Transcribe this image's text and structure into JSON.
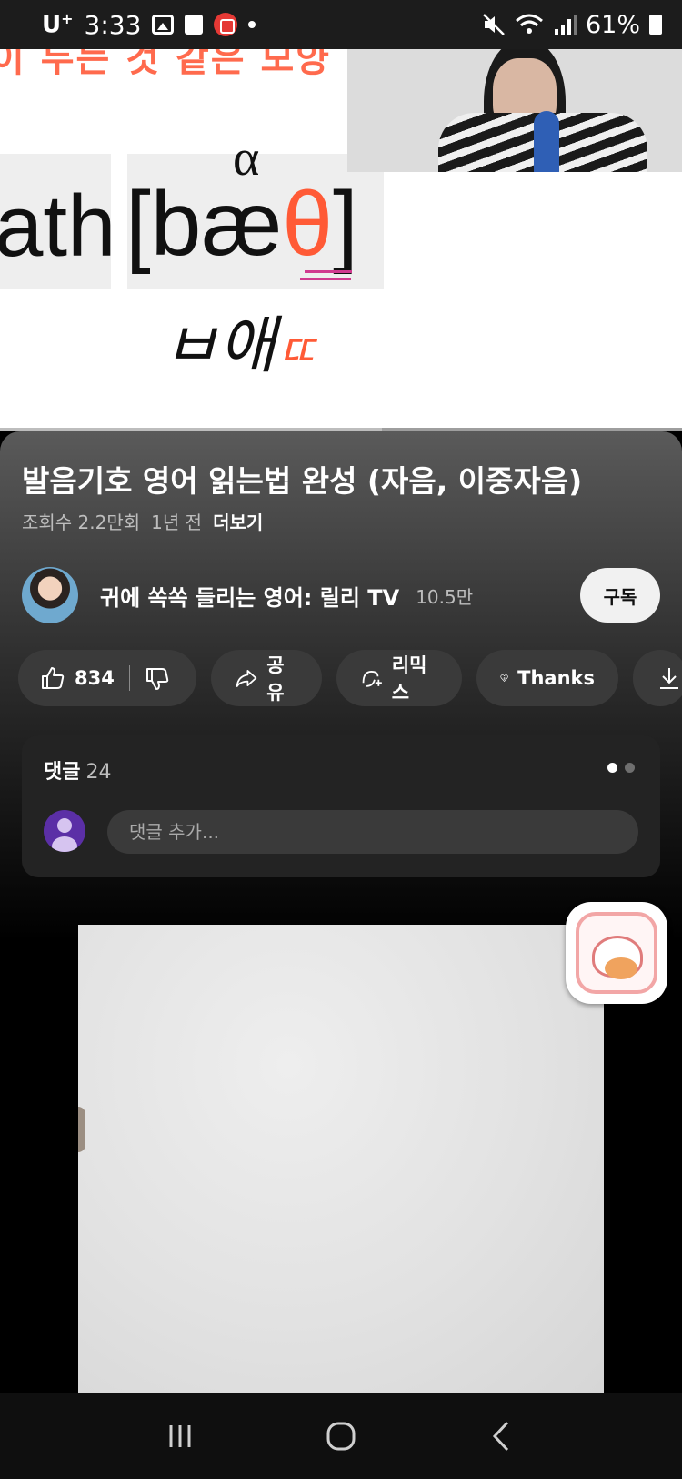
{
  "status_bar": {
    "carrier": "U",
    "carrier_sup": "+",
    "time": "3:33",
    "battery": "61%"
  },
  "video": {
    "top_text": "이 두는 것 같은 모양",
    "word": "ath",
    "phonetic_open": "[bæ",
    "phonetic_theta": "θ",
    "phonetic_close": "]",
    "alpha": "α",
    "hangul_main": "ㅂ애",
    "hangul_red": "ㄸ",
    "progress_fraction": 0.56
  },
  "details": {
    "title": "발음기호 영어 읽는법 완성 (자음, 이중자음)",
    "views": "조회수 2.2만회",
    "age": "1년 전",
    "more": "더보기"
  },
  "channel": {
    "name": "귀에 쏙쏙 들리는 영어: 릴리 TV",
    "subscribers": "10.5만",
    "subscribe_label": "구독"
  },
  "actions": {
    "like_count": "834",
    "share_label": "공유",
    "remix_label": "리믹스",
    "thanks_label": "Thanks"
  },
  "comments": {
    "label": "댓글",
    "count": "24",
    "placeholder": "댓글 추가..."
  },
  "icons": {
    "like": "thumbs-up-icon",
    "dislike": "thumbs-down-icon",
    "share": "share-arrow-icon",
    "remix": "remix-icon",
    "thanks": "heart-dollar-icon",
    "download": "download-icon"
  },
  "colors": {
    "accent_red": "#ff5a36",
    "subscribe_bg": "#f1f1f1",
    "pill_bg": "#3a3a3a"
  }
}
